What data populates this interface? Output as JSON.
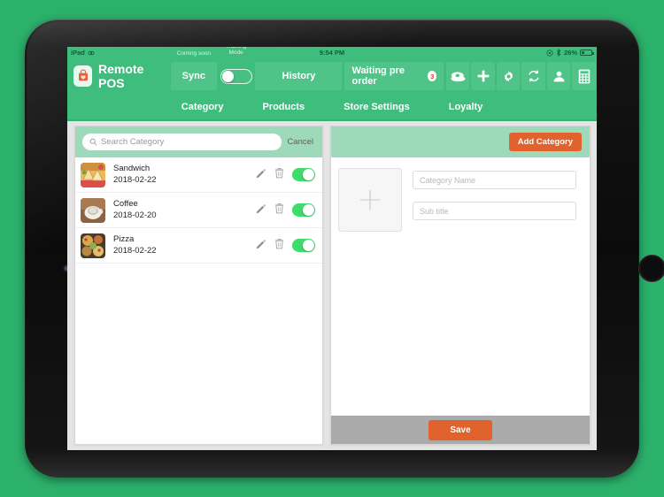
{
  "device": {
    "name": "iPad"
  },
  "status_bar": {
    "device_label": "iPad",
    "time": "9:54 PM",
    "battery_percent": "26%",
    "icons": [
      "bluetooth-icon",
      "location-icon",
      "battery-icon"
    ]
  },
  "header": {
    "app_title": "Remote POS",
    "logo_icon": "shopping-bag-icon",
    "sync": {
      "overlabel": "Coming soon",
      "label": "Sync"
    },
    "training_mode": {
      "overlabel": "Training\nMode",
      "label_line1": "Training",
      "label_line2": "Mode",
      "state": "off"
    },
    "history": {
      "label": "History"
    },
    "pre_order": {
      "label": "Waiting pre order",
      "count": "3"
    },
    "tool_icons": [
      "cash-icon",
      "plus-icon",
      "gear-icon",
      "refresh-icon",
      "person-icon",
      "calculator-icon"
    ]
  },
  "nav": {
    "tabs": [
      {
        "label": "Category",
        "active": true
      },
      {
        "label": "Products",
        "active": false
      },
      {
        "label": "Store Settings",
        "active": false
      },
      {
        "label": "Loyalty",
        "active": false
      }
    ]
  },
  "left_panel": {
    "search": {
      "placeholder": "Search Category",
      "value": "",
      "icon": "search-icon"
    },
    "cancel_label": "Cancel",
    "rows": [
      {
        "title": "Sandwich",
        "date": "2018-02-22",
        "enabled": true,
        "thumb": "sandwich-photo"
      },
      {
        "title": "Coffee",
        "date": "2018-02-20",
        "enabled": true,
        "thumb": "coffee-photo"
      },
      {
        "title": "Pizza",
        "date": "2018-02-22",
        "enabled": true,
        "thumb": "pizza-photo"
      }
    ],
    "row_actions": {
      "edit_icon": "pencil-icon",
      "delete_icon": "trash-icon",
      "toggle": "enable-toggle"
    }
  },
  "right_panel": {
    "add_category_label": "Add Category",
    "image_upload": {
      "icon": "plus-icon",
      "label": ""
    },
    "category_name": {
      "placeholder": "Category Name",
      "value": ""
    },
    "sub_title": {
      "placeholder": "Sub title",
      "value": ""
    },
    "save_label": "Save"
  },
  "colors": {
    "background_green": "#2cb16b",
    "header_green": "#3fbd7d",
    "panel_header_green": "#9ed9b9",
    "accent_orange": "#e1622c",
    "toggle_green": "#3fdb6b",
    "footer_gray": "#aaaaaa",
    "badge_red": "#e03a2f"
  }
}
